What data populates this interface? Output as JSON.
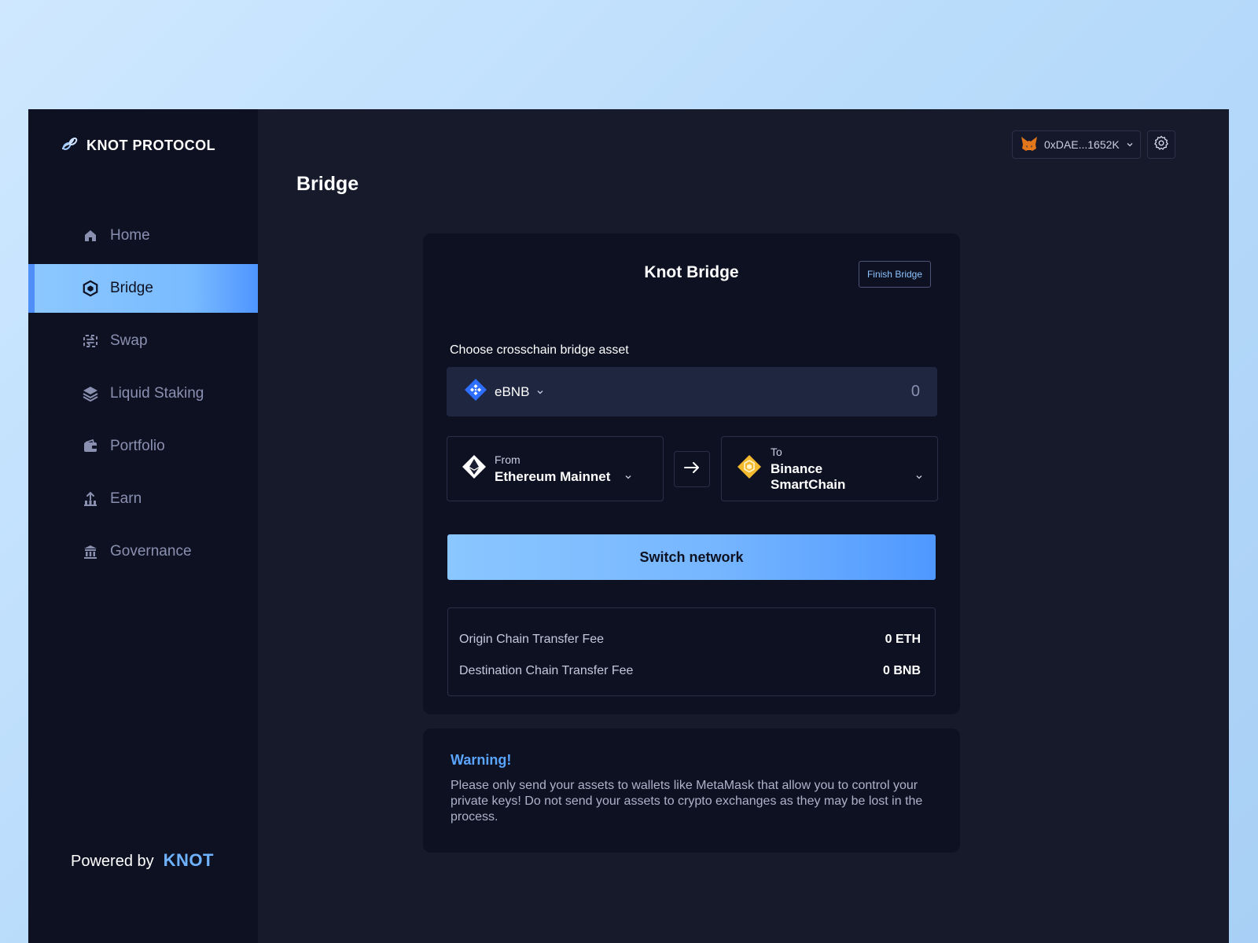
{
  "brand": {
    "name": "KNOT PROTOCOL"
  },
  "sidebar": {
    "items": [
      {
        "label": "Home",
        "icon": "home-icon",
        "active": false
      },
      {
        "label": "Bridge",
        "icon": "bridge-icon",
        "active": true
      },
      {
        "label": "Swap",
        "icon": "swap-icon",
        "active": false
      },
      {
        "label": "Liquid Staking",
        "icon": "layers-icon",
        "active": false
      },
      {
        "label": "Portfolio",
        "icon": "wallet-icon",
        "active": false
      },
      {
        "label": "Earn",
        "icon": "earn-icon",
        "active": false
      },
      {
        "label": "Governance",
        "icon": "bank-icon",
        "active": false
      }
    ],
    "powered_by": "Powered by",
    "powered_brand": "KNOT"
  },
  "header": {
    "page_title": "Bridge",
    "wallet_address": "0xDAE...1652K",
    "wallet_icon": "metamask-fox-icon",
    "settings_icon": "gear-icon"
  },
  "bridge_card": {
    "title": "Knot Bridge",
    "finish_label": "Finish Bridge",
    "asset_label": "Choose crosschain bridge asset",
    "asset": {
      "symbol": "eBNB",
      "icon": "bnb-icon",
      "amount": "0"
    },
    "from": {
      "sub": "From",
      "name": "Ethereum Mainnet",
      "icon": "ethereum-icon"
    },
    "to": {
      "sub": "To",
      "name": "Binance SmartChain",
      "icon": "bnb-icon"
    },
    "switch_label": "Switch network",
    "fees": [
      {
        "label": "Origin Chain Transfer Fee",
        "value": "0 ETH"
      },
      {
        "label": "Destination Chain Transfer Fee",
        "value": "0 BNB"
      }
    ]
  },
  "warning": {
    "title": "Warning!",
    "text": "Please only send your assets to wallets like MetaMask that allow you to control your private keys! Do not send your assets to crypto exchanges as they may be lost in the process."
  },
  "colors": {
    "accent": "#5aa5ff",
    "sidebar_bg": "#0e1122",
    "main_bg": "#161a2b",
    "binance_yellow": "#f3ba2f",
    "ebnb_blue": "#2f6fff"
  }
}
